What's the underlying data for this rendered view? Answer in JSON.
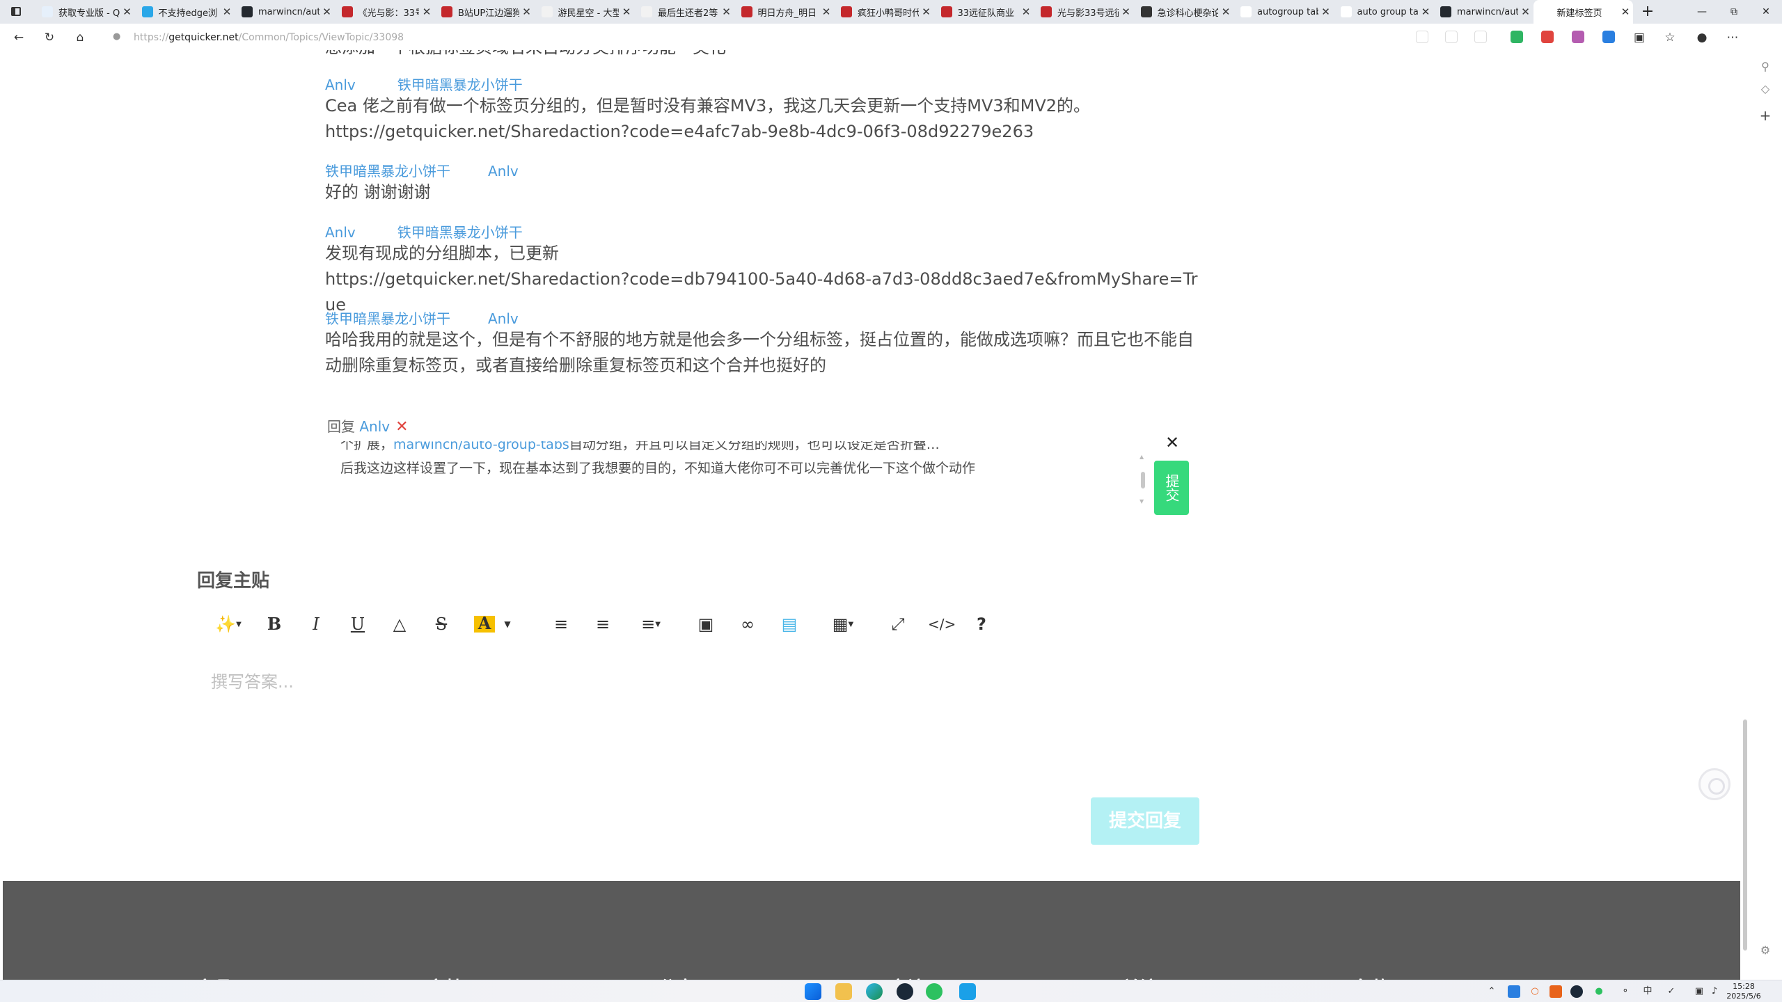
{
  "browser": {
    "tabs": [
      {
        "title": "获取专业版 - Q",
        "active": false,
        "favicon_color": "#e6f0fb"
      },
      {
        "title": "不支持edge浏",
        "active": false,
        "favicon_color": "#2aa7e8"
      },
      {
        "title": "marwincn/auto",
        "active": false,
        "favicon_color": "#24292f"
      },
      {
        "title": "《光与影：33号",
        "active": false,
        "favicon_color": "#c4282c"
      },
      {
        "title": "B站UP江边遛狗",
        "active": false,
        "favicon_color": "#c4282c"
      },
      {
        "title": "游民星空 - 大型",
        "active": false,
        "favicon_color": "#f2f2f2"
      },
      {
        "title": "最后生还者2等",
        "active": false,
        "favicon_color": "#f2f2f2"
      },
      {
        "title": "明日方舟_明日",
        "active": false,
        "favicon_color": "#c4282c"
      },
      {
        "title": "疯狂小鸭哥时代",
        "active": false,
        "favicon_color": "#c4282c"
      },
      {
        "title": "33远征队商业",
        "active": false,
        "favicon_color": "#c4282c"
      },
      {
        "title": "光与影33号远征",
        "active": false,
        "favicon_color": "#c4282c"
      },
      {
        "title": "急诊科心梗杂论",
        "active": false,
        "favicon_color": "#333333"
      },
      {
        "title": "autogroup tab",
        "active": false,
        "favicon_color": "#ffffff"
      },
      {
        "title": "auto group tab",
        "active": false,
        "favicon_color": "#ffffff"
      },
      {
        "title": "marwincn/auto",
        "active": false,
        "favicon_color": "#24292f"
      },
      {
        "title": "新建标签页",
        "active": true,
        "favicon_color": "#ffffff"
      }
    ],
    "url_prefix": "https://",
    "url_domain": "getquicker.net",
    "url_path": "/Common/Topics/ViewTopic/33098"
  },
  "page": {
    "top_cut_text": "想添加一个根据标签页域名来自动分类排序功能一类化",
    "comments": [
      {
        "author": "Anlv",
        "to": "铁甲暗黑暴龙小饼干",
        "lines": [
          "Cea 佬之前有做一个标签页分组的，但是暂时没有兼容MV3，我这几天会更新一个支持MV3和MV2的。",
          "https://getquicker.net/Sharedaction?code=e4afc7ab-9e8b-4dc9-06f3-08d92279e263"
        ]
      },
      {
        "author": "铁甲暗黑暴龙小饼干",
        "to": "Anlv",
        "lines": [
          "好的 谢谢谢谢"
        ]
      },
      {
        "author": "Anlv",
        "to": "铁甲暗黑暴龙小饼干",
        "lines": [
          "发现有现成的分组脚本，已更新",
          "https://getquicker.net/Sharedaction?code=db794100-5a40-4d68-a7d3-08dd8c3aed7e&fromMyShare=True"
        ]
      },
      {
        "author": "铁甲暗黑暴龙小饼干",
        "to": "Anlv",
        "lines": [
          "哈哈我用的就是这个，但是有个不舒服的地方就是他会多一个分组标签，挺占位置的，能做成选项嘛？而且它也不能自动删除重复标签页，或者直接给删除重复标签页和这个合并也挺好的"
        ]
      }
    ],
    "reply": {
      "prefix": "回复",
      "target": "Anlv",
      "cancel_icon": "✕",
      "text_partial": "个扩展，",
      "text_link": "marwincn/auto-group-tabs",
      "text_rest": "自动分组，并且可以自定义分组的规则，也可以设定是否折叠…",
      "text_line2": "后我这边这样设置了一下，现在基本达到了我想要的目的，不知道大佬你可不可以完善优化一下这个做个动作",
      "close_icon": "✕",
      "submit_label": "提交"
    },
    "reply_main_title": "回复主贴",
    "editor": {
      "placeholder": "撰写答案...",
      "toolbar": [
        "magic-wand",
        "bold",
        "italic",
        "underline",
        "eraser",
        "strikethrough",
        "font-color",
        "bullet-list",
        "numbered-list",
        "align",
        "image",
        "link",
        "calendar",
        "table",
        "fullscreen",
        "code",
        "help"
      ]
    },
    "submit_reply_label": "提交回复",
    "footer_headings": [
      "产品",
      "文档",
      "分享",
      "交流",
      "关注",
      "条款"
    ]
  },
  "taskbar": {
    "time": "15:28",
    "date": "2025/5/6"
  }
}
